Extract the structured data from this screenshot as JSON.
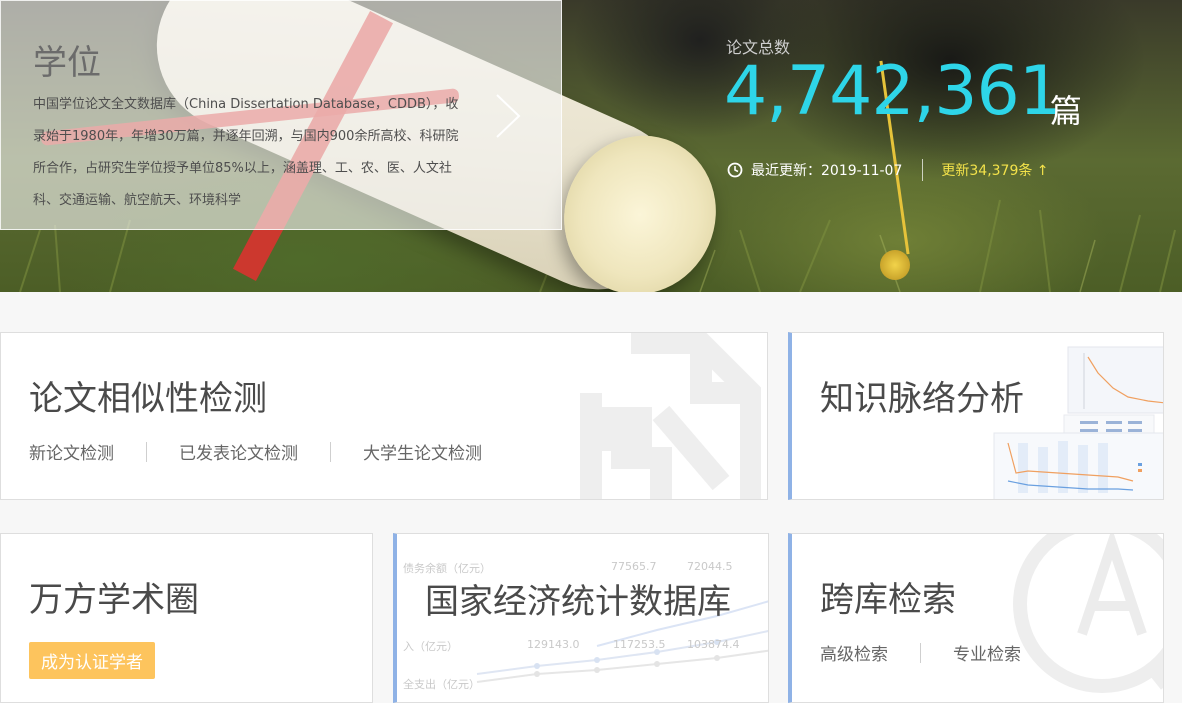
{
  "hero": {
    "title": "学位",
    "description": "中国学位论文全文数据库（China Dissertation Database，CDDB），收录始于1980年，年增30万篇，并逐年回溯，与国内900余所高校、科研院所合作，占研究生学位授予单位85%以上，涵盖理、工、农、医、人文社科、交通运输、航空航天、环境科学",
    "stats_label": "论文总数",
    "total_count": "4,742,361",
    "unit": "篇",
    "last_update": "最近更新：2019-11-07",
    "update_increase": "更新34,379条 ↑"
  },
  "cards": {
    "similarity": {
      "title": "论文相似性检测",
      "links": [
        "新论文检测",
        "已发表论文检测",
        "大学生论文检测"
      ]
    },
    "knowledge": {
      "title": "知识脉络分析"
    },
    "scholar": {
      "title": "万方学术圈",
      "button": "成为认证学者"
    },
    "econ": {
      "title": "国家经济统计数据库",
      "bg_rows": [
        [
          "债务余额（亿元）",
          "77565.7",
          "72044.5"
        ],
        [
          "入（亿元）",
          "129143.0",
          "117253.5",
          "103874.4"
        ],
        [
          "全支出（亿元）"
        ]
      ]
    },
    "cross": {
      "title": "跨库检索",
      "links": [
        "高级检索",
        "专业检索"
      ]
    }
  },
  "colors": {
    "accent_cyan": "#2ed5e8",
    "accent_yellow": "#f3e24a",
    "button_orange": "#fdc45d",
    "card_accent_blue": "#8fb2e6"
  }
}
